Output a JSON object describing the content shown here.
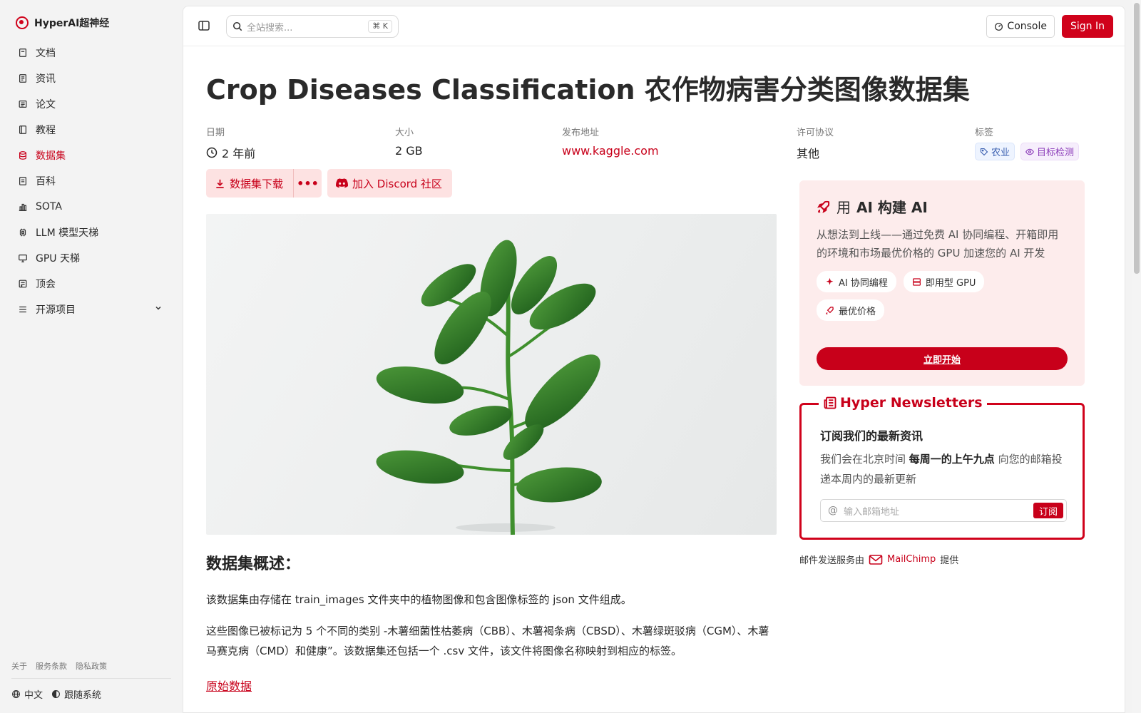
{
  "brand": {
    "name": "HyperAI超神经"
  },
  "sidebar": {
    "items": [
      {
        "label": "文档",
        "icon": "book-icon"
      },
      {
        "label": "资讯",
        "icon": "news-icon"
      },
      {
        "label": "论文",
        "icon": "paper-icon"
      },
      {
        "label": "教程",
        "icon": "tutorial-icon"
      },
      {
        "label": "数据集",
        "icon": "database-icon",
        "active": true
      },
      {
        "label": "百科",
        "icon": "encyclopedia-icon"
      },
      {
        "label": "SOTA",
        "icon": "bar-chart-icon"
      },
      {
        "label": "LLM 模型天梯",
        "icon": "chip-icon"
      },
      {
        "label": "GPU 天梯",
        "icon": "monitor-icon"
      },
      {
        "label": "顶会",
        "icon": "conference-icon"
      },
      {
        "label": "开源项目",
        "icon": "list-icon"
      }
    ],
    "footer_links": [
      "关于",
      "服务条款",
      "隐私政策"
    ],
    "language": "中文",
    "theme": "跟随系统"
  },
  "topbar": {
    "search_placeholder": "全站搜索...",
    "search_shortcut": "K",
    "console_label": "Console",
    "signin_label": "Sign In"
  },
  "dataset": {
    "title": "Crop Diseases Classification 农作物病害分类图像数据集",
    "meta": {
      "date_label": "日期",
      "date_value": "2 年前",
      "size_label": "大小",
      "size_value": "2 GB",
      "publisher_label": "发布地址",
      "publisher_value": "www.kaggle.com",
      "license_label": "许可协议",
      "license_value": "其他",
      "tags_label": "标签",
      "tags": [
        "农业",
        "目标检测"
      ]
    },
    "download_label": "数据集下载",
    "more_label": "•••",
    "discord_label": "加入 Discord 社区",
    "overview_heading": "数据集概述：",
    "para1": "该数据集由存储在 train_images 文件夹中的植物图像和包含图像标签的 json 文件组成。",
    "para2": "这些图像已被标记为 5 个不同的类别 -木薯细菌性枯萎病（CBB）、木薯褐条病（CBSD）、木薯绿斑驳病（CGM）、木薯马赛克病（CMD）和健康”。该数据集还包括一个 .csv 文件，该文件将图像名称映射到相应的标签。",
    "raw_link": "原始数据"
  },
  "ai_card": {
    "title_prefix": "用",
    "title_main": "AI 构建 AI",
    "desc": "从想法到上线——通过免费 AI 协同编程、开箱即用的环境和市场最优价格的 GPU 加速您的 AI 开发",
    "chips": [
      "AI 协同编程",
      "即用型 GPU",
      "最优价格"
    ],
    "cta": "立即开始"
  },
  "newsletter": {
    "legend": "Hyper Newsletters",
    "heading": "订阅我们的最新资讯",
    "text_pre": "我们会在北京时间",
    "text_bold": "每周一的上午九点",
    "text_post": "向您的邮箱投递本周内的最新更新",
    "input_placeholder": "输入邮箱地址",
    "subscribe": "订阅",
    "note_pre": "邮件发送服务由",
    "note_brand": "MailChimp",
    "note_post": "提供"
  },
  "colors": {
    "accent": "#d0021b",
    "soft_accent": "#fdecec"
  }
}
